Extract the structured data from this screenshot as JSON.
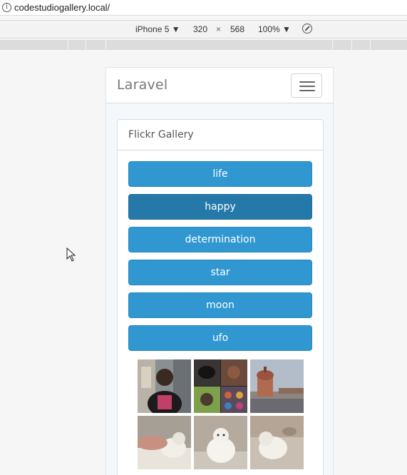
{
  "browser": {
    "url": "codestudiogallery.local/"
  },
  "devtools": {
    "device": "iPhone 5 ▼",
    "width": "320",
    "times": "×",
    "height": "568",
    "zoom": "100% ▼"
  },
  "app": {
    "brand": "Laravel",
    "panel_title": "Flickr Gallery",
    "tags": [
      "life",
      "happy",
      "determination",
      "star",
      "moon",
      "ufo"
    ],
    "active_tag": "happy",
    "thumbnails": [
      {
        "icon": "portrait-photo"
      },
      {
        "icon": "collage-photo"
      },
      {
        "icon": "tower-photo"
      },
      {
        "icon": "kitten-photo"
      },
      {
        "icon": "kitten-photo"
      },
      {
        "icon": "kitten-photo"
      }
    ]
  },
  "colors": {
    "button": "#3097d1",
    "button_active": "#2579a9",
    "panel_border": "#d3e0e9"
  }
}
